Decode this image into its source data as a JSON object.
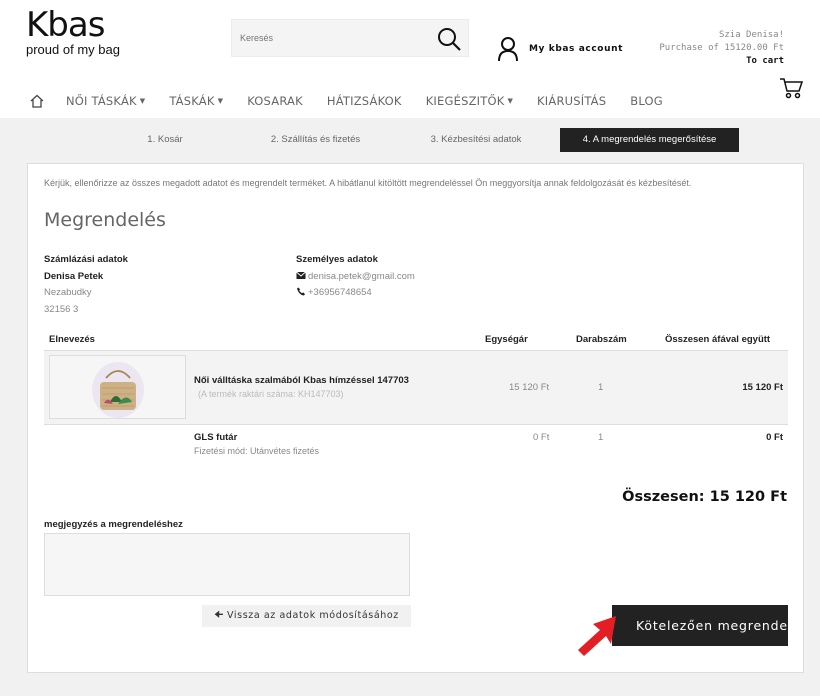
{
  "header": {
    "logo_main": "Kbas",
    "logo_sub": "proud of my bag",
    "search_placeholder": "Keresés",
    "account_label": "My kbas account",
    "greeting": "Szia Denisa!",
    "purchase": "Purchase of 15120.00 Ft",
    "to_cart": "To cart"
  },
  "nav": {
    "items": [
      {
        "label": "NŐI TÁSKÁK",
        "dropdown": true
      },
      {
        "label": "TÁSKÁK",
        "dropdown": true
      },
      {
        "label": "KOSARAK",
        "dropdown": false
      },
      {
        "label": "HÁTIZSÁKOK",
        "dropdown": false
      },
      {
        "label": "KIEGÉSZITŐK",
        "dropdown": true
      },
      {
        "label": "KIÁRUSÍTÁS",
        "dropdown": false
      },
      {
        "label": "BLOG",
        "dropdown": false
      }
    ]
  },
  "steps": [
    {
      "label": "1. Kosár",
      "active": false
    },
    {
      "label": "2. Szállítás és fizetés",
      "active": false
    },
    {
      "label": "3. Kézbesítési adatok",
      "active": false
    },
    {
      "label": "4. A megrendelés megerősítése",
      "active": true
    }
  ],
  "order": {
    "notice": "Kérjük, ellenőrizze az összes megadott adatot és megrendelt terméket. A hibátlanul kitöltött megrendeléssel Ön meggyorsítja annak feldolgozását és kézbesítését.",
    "title": "Megrendelés",
    "billing": {
      "heading": "Számlázási adatok",
      "name": "Denisa Petek",
      "street": "Nezabudky",
      "zip": "32156 3"
    },
    "personal": {
      "heading": "Személyes adatok",
      "email": "denisa.petek@gmail.com",
      "phone": "+36956748654"
    },
    "table": {
      "headers": {
        "name": "Elnevezés",
        "unit_price": "Egységár",
        "quantity": "Darabszám",
        "total": "Összesen áfával együtt"
      },
      "product": {
        "name": "Női válltáska szalmából Kbas hímzéssel 147703",
        "sub": "(A termék raktári száma: KH147703)",
        "unit_price": "15 120 Ft",
        "quantity": "1",
        "total": "15 120 Ft"
      },
      "shipping": {
        "name": "GLS futár",
        "payment": "Fizetési mód: Utánvétes fizetés",
        "unit_price": "0 Ft",
        "quantity": "1",
        "total": "0 Ft"
      }
    },
    "grand_total": "Összesen: 15 120 Ft",
    "note_label": "megjegyzés a megrendeléshez",
    "back_button": "Vissza az adatok módosításához",
    "submit_button": "Kötelezően megrendelem"
  },
  "colors": {
    "dark": "#222222",
    "arrow_red": "#e31e24",
    "background": "#f1f1f1"
  }
}
